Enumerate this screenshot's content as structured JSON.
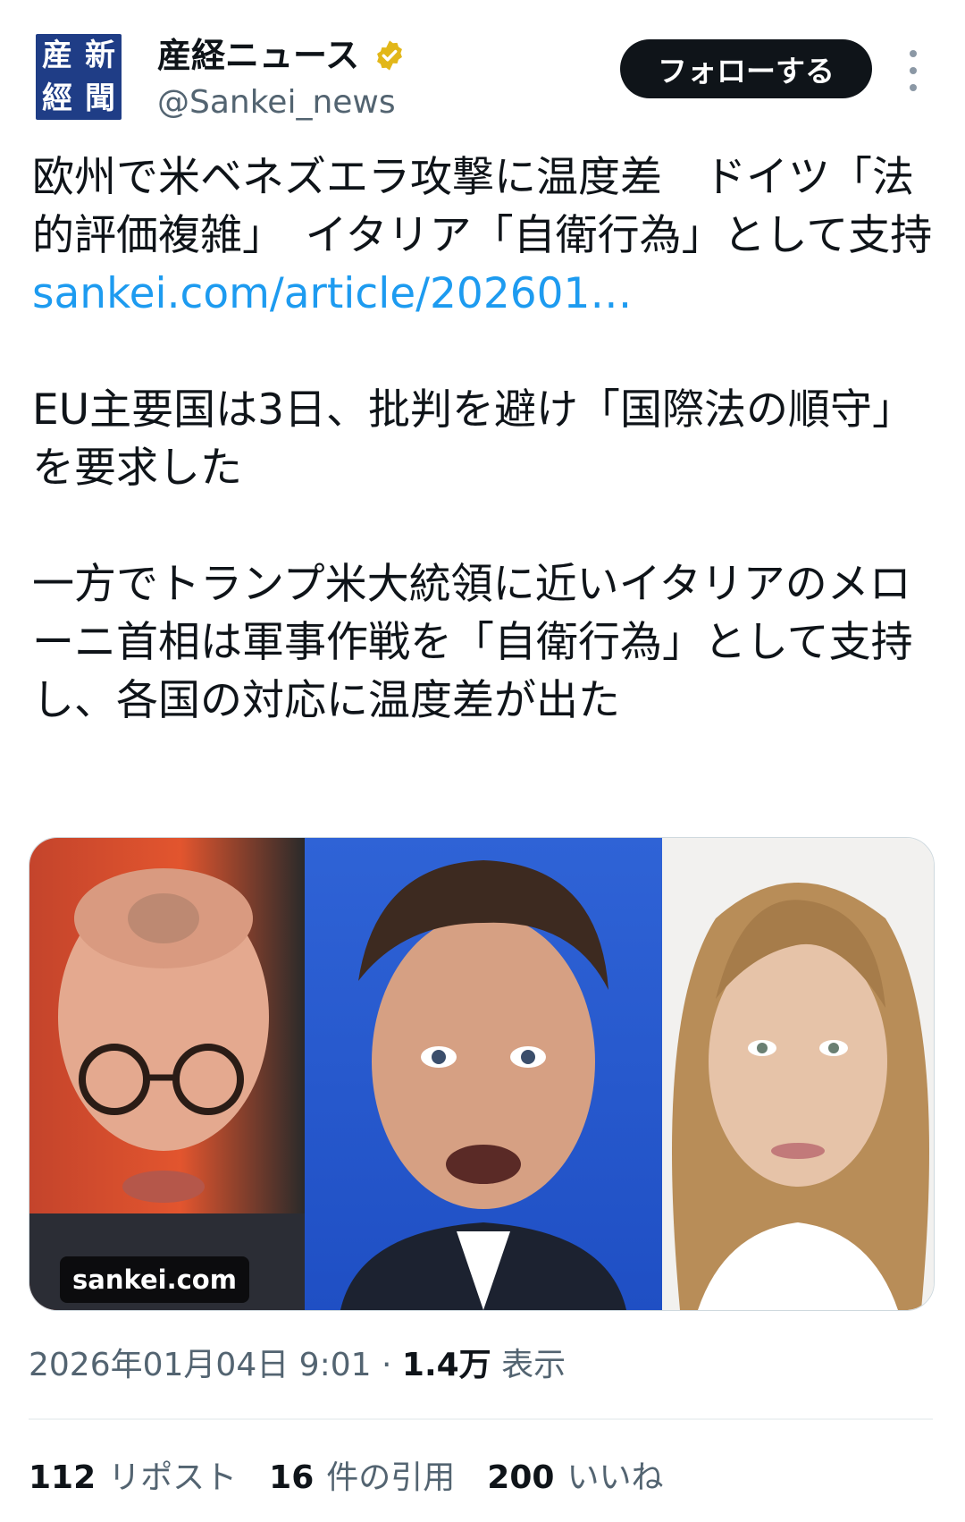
{
  "account": {
    "avatar_chars": [
      "新",
      "産",
      "聞",
      "經"
    ],
    "display_name": "産経ニュース",
    "handle": "@Sankei_news",
    "verified_icon": "verified-badge-icon",
    "follow_label": "フォローする",
    "more_icon": "more-vertical-icon"
  },
  "tweet": {
    "line1": "欧州で米ベネズエラ攻撃に温度差　ドイツ「法的評価複雑」　イタリア「自衛行為」として支持",
    "link": "sankei.com/article/202601…",
    "para2": "EU主要国は3日、批判を避け「国際法の順守」を要求した",
    "para3": "一方でトランプ米大統領に近いイタリアのメローニ首相は軍事作戦を「自衛行為」として支持し、各国の対応に温度差が出た"
  },
  "media": {
    "domain_label": "sankei.com"
  },
  "meta": {
    "date": "2026年01月04日 9:01",
    "separator": "·",
    "views_count": "1.4万",
    "views_label": "表示"
  },
  "stats": {
    "reposts_count": "112",
    "reposts_label": "リポスト",
    "quotes_count": "16",
    "quotes_label": "件の引用",
    "likes_count": "200",
    "likes_label": "いいね"
  },
  "colors": {
    "link": "#1d9bf0",
    "secondary_text": "#536471",
    "verified": "#e2b719",
    "avatar_bg": "#1f3d86"
  }
}
